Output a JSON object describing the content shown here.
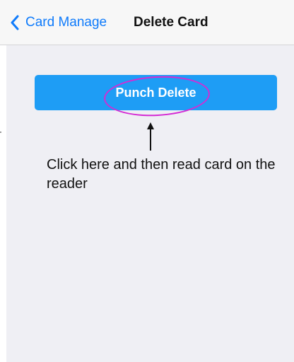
{
  "navbar": {
    "back_label": "Card Manage",
    "title": "Delete Card",
    "back_icon": "chevron-left-icon"
  },
  "main": {
    "action_button_label": "Punch Delete",
    "annotation_text": "Click here and then read card on the reader",
    "arrow_icon": "arrow-up-icon"
  },
  "colors": {
    "accent": "#0f7bfb",
    "button": "#1e9df5",
    "highlight": "#d42bd4",
    "background": "#efeff4"
  }
}
